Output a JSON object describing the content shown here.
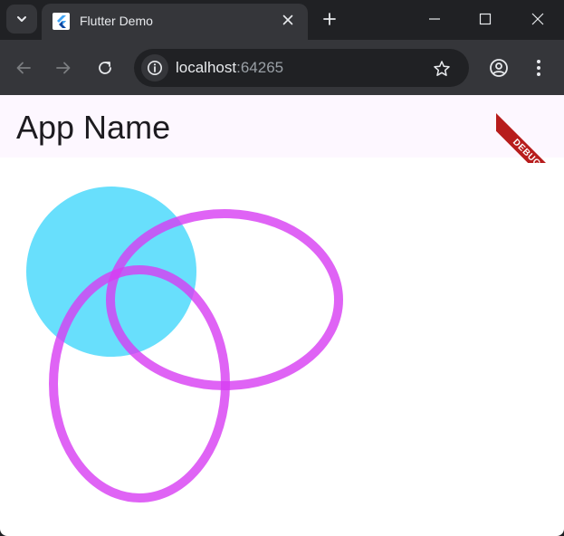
{
  "browser": {
    "tab": {
      "title": "Flutter Demo"
    },
    "address_bar": {
      "host": "localhost",
      "port": ":64265"
    },
    "icons": {
      "tab_search": "chevron-down-icon",
      "favicon": "flutter-logo-icon",
      "tab_close": "close-icon",
      "new_tab": "plus-icon",
      "minimize": "minimize-icon",
      "maximize": "maximize-icon",
      "window_close": "close-icon",
      "back": "arrow-left-icon",
      "forward": "arrow-right-icon",
      "reload": "reload-icon",
      "site_info": "info-icon",
      "bookmark": "star-icon",
      "profile": "account-circle-icon",
      "menu": "more-vert-icon"
    }
  },
  "app": {
    "title": "App Name",
    "debug_banner": "DEBUG",
    "colors": {
      "appbar_background": "#fdf7ff",
      "circle_fill": "#4dd9fb",
      "ellipse_stroke": "#d73cf3",
      "debug_banner": "#b71c1c"
    },
    "shapes": [
      {
        "name": "filled-circle",
        "kind": "circle",
        "fill": "#4dd9fb",
        "opacity": 0.85
      },
      {
        "name": "horizontal-ellipse-ring",
        "kind": "ellipse-outline",
        "stroke": "#d73cf3",
        "opacity": 0.8
      },
      {
        "name": "vertical-ellipse-ring",
        "kind": "ellipse-outline",
        "stroke": "#d73cf3",
        "opacity": 0.8
      }
    ]
  }
}
